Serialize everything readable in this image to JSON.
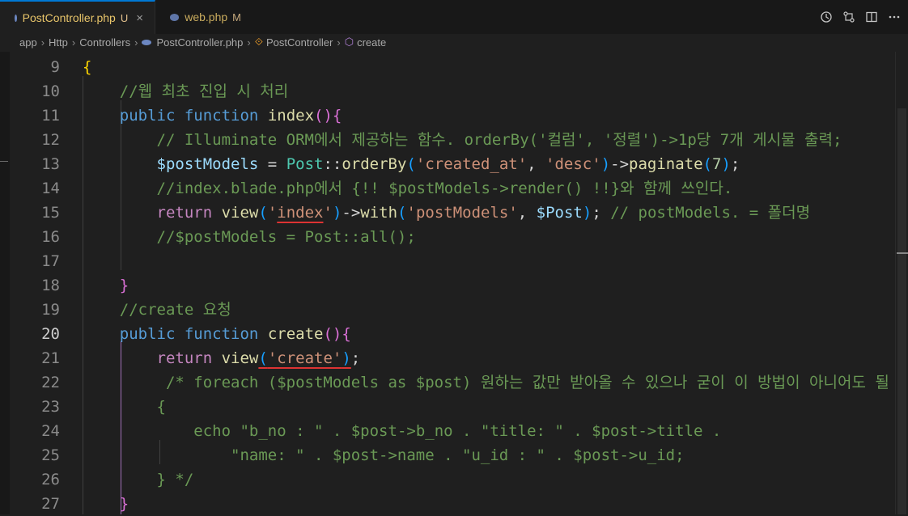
{
  "tabs": [
    {
      "label": "PostController.php",
      "status": "U",
      "active": true
    },
    {
      "label": "web.php",
      "status": "M",
      "active": false
    }
  ],
  "toolbar_icons": [
    "history-icon",
    "compare-changes-icon",
    "split-editor-icon",
    "more-actions-icon"
  ],
  "breadcrumb": [
    "app",
    "Http",
    "Controllers",
    "PostController.php",
    "PostController",
    "create"
  ],
  "colors": {
    "active_tab_border": "#0078d4",
    "modified_file": "#e8c56a",
    "error_underline": "#dd3333"
  },
  "current_line": 20,
  "lines": [
    {
      "num": "9",
      "tokens": [
        {
          "t": "{",
          "c": "b1"
        }
      ]
    },
    {
      "num": "10",
      "tokens": [
        {
          "t": "    "
        },
        {
          "t": "//웹 최초 진입 시 처리",
          "c": "c"
        }
      ]
    },
    {
      "num": "11",
      "tokens": [
        {
          "t": "    "
        },
        {
          "t": "public",
          "c": "k"
        },
        {
          "t": " "
        },
        {
          "t": "function",
          "c": "k"
        },
        {
          "t": " "
        },
        {
          "t": "index",
          "c": "f"
        },
        {
          "t": "()",
          "c": "b2"
        },
        {
          "t": "{",
          "c": "b2"
        }
      ]
    },
    {
      "num": "12",
      "tokens": [
        {
          "t": "        "
        },
        {
          "t": "// Illuminate ORM에서 제공하는 함수. orderBy('컬럼', '정렬')->1p당 7개 게시물 출력;",
          "c": "c"
        }
      ]
    },
    {
      "num": "13",
      "tokens": [
        {
          "t": "        "
        },
        {
          "t": "$postModels",
          "c": "v"
        },
        {
          "t": " = "
        },
        {
          "t": "Post",
          "c": "t"
        },
        {
          "t": "::"
        },
        {
          "t": "orderBy",
          "c": "f"
        },
        {
          "t": "(",
          "c": "b3"
        },
        {
          "t": "'created_at'",
          "c": "s"
        },
        {
          "t": ", "
        },
        {
          "t": "'desc'",
          "c": "s"
        },
        {
          "t": ")",
          "c": "b3"
        },
        {
          "t": "->"
        },
        {
          "t": "paginate",
          "c": "f"
        },
        {
          "t": "(",
          "c": "b3"
        },
        {
          "t": "7",
          "c": "n"
        },
        {
          "t": ")",
          "c": "b3"
        },
        {
          "t": ";"
        }
      ]
    },
    {
      "num": "14",
      "tokens": [
        {
          "t": "        "
        },
        {
          "t": "//index.blade.php에서 {!! $postModels->render() !!}와 함께 쓰인다.",
          "c": "c"
        }
      ]
    },
    {
      "num": "15",
      "tokens": [
        {
          "t": "        "
        },
        {
          "t": "return",
          "c": "r"
        },
        {
          "t": " "
        },
        {
          "t": "view",
          "c": "f"
        },
        {
          "t": "(",
          "c": "b3"
        },
        {
          "t": "'",
          "c": "s"
        },
        {
          "t": "index",
          "c": "s",
          "u": true
        },
        {
          "t": "'",
          "c": "s"
        },
        {
          "t": ")",
          "c": "b3"
        },
        {
          "t": "->"
        },
        {
          "t": "with",
          "c": "f"
        },
        {
          "t": "(",
          "c": "b3"
        },
        {
          "t": "'postModels'",
          "c": "s"
        },
        {
          "t": ", "
        },
        {
          "t": "$Post",
          "c": "v"
        },
        {
          "t": ")",
          "c": "b3"
        },
        {
          "t": "; "
        },
        {
          "t": "// postModels. = 폴더명",
          "c": "c"
        }
      ]
    },
    {
      "num": "16",
      "tokens": [
        {
          "t": "        "
        },
        {
          "t": "//$postModels = Post::all();",
          "c": "c"
        }
      ]
    },
    {
      "num": "17",
      "tokens": []
    },
    {
      "num": "18",
      "tokens": [
        {
          "t": "    "
        },
        {
          "t": "}",
          "c": "b2"
        }
      ]
    },
    {
      "num": "19",
      "tokens": [
        {
          "t": "    "
        },
        {
          "t": "//create 요청",
          "c": "c"
        }
      ]
    },
    {
      "num": "20",
      "tokens": [
        {
          "t": "    "
        },
        {
          "t": "public",
          "c": "k"
        },
        {
          "t": " "
        },
        {
          "t": "function",
          "c": "k"
        },
        {
          "t": " "
        },
        {
          "t": "create",
          "c": "f"
        },
        {
          "t": "()",
          "c": "b2"
        },
        {
          "t": "{",
          "c": "b2"
        }
      ]
    },
    {
      "num": "21",
      "tokens": [
        {
          "t": "        "
        },
        {
          "t": "return",
          "c": "r"
        },
        {
          "t": " "
        },
        {
          "t": "view",
          "c": "f"
        },
        {
          "t": "(",
          "c": "b3",
          "u": true
        },
        {
          "t": "'create'",
          "c": "s",
          "u": true
        },
        {
          "t": ")",
          "c": "b3",
          "u": true
        },
        {
          "t": ";"
        }
      ]
    },
    {
      "num": "22",
      "tokens": [
        {
          "t": "         "
        },
        {
          "t": "/* foreach ($postModels as $post) 원하는 값만 받아올 수 있으나 굳이 이 방법이 아니어도 될",
          "c": "c"
        }
      ]
    },
    {
      "num": "23",
      "tokens": [
        {
          "t": "        "
        },
        {
          "t": "{",
          "c": "c"
        }
      ]
    },
    {
      "num": "24",
      "tokens": [
        {
          "t": "            "
        },
        {
          "t": "echo \"b_no : \" . $post->b_no . \"title: \" . $post->title .",
          "c": "c"
        }
      ]
    },
    {
      "num": "25",
      "tokens": [
        {
          "t": "                "
        },
        {
          "t": "\"name: \" . $post->name . \"u_id : \" . $post->u_id;",
          "c": "c"
        }
      ]
    },
    {
      "num": "26",
      "tokens": [
        {
          "t": "        "
        },
        {
          "t": "} */",
          "c": "c"
        }
      ]
    },
    {
      "num": "27",
      "tokens": [
        {
          "t": "    "
        },
        {
          "t": "}",
          "c": "b2"
        }
      ]
    }
  ]
}
